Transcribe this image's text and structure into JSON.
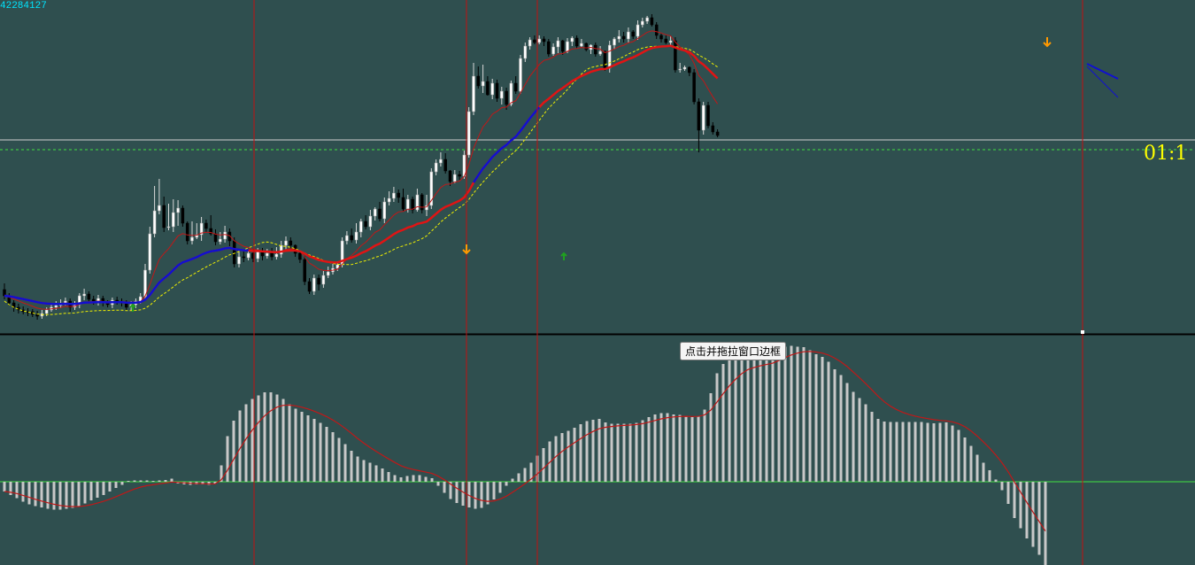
{
  "top_left_label": "42284127",
  "price_label": "01:1",
  "tooltip": "点击并拖拉窗口边框",
  "colors": {
    "background": "#2f4f4f",
    "bull_candle": "#ffffff",
    "bear_candle": "#000000",
    "ma_fast": "#c01818",
    "ma_mid": "#e01414",
    "ma_slow": "#f0f000",
    "ma_blue": "#1010d0",
    "vertical_lines": "#c01010",
    "macd_bars": "#c8c8c8",
    "macd_signal": "#c01818",
    "zero_line": "#40e040",
    "level_line": "#d0d0d0",
    "level_dashed": "#40e040",
    "up_arrow": "#20a020",
    "down_arrow": "#ff9900",
    "id_text": "#00e5ff",
    "price_text": "#ffff00"
  },
  "chart_data": {
    "type": "candlestick",
    "candles": [
      [
        327,
        334,
        320,
        338
      ],
      [
        334,
        342,
        331,
        345
      ],
      [
        342,
        347,
        339,
        352
      ],
      [
        347,
        350,
        343,
        354
      ],
      [
        350,
        352,
        346,
        355
      ],
      [
        352,
        352,
        348,
        357
      ],
      [
        352,
        355,
        349,
        358
      ],
      [
        355,
        357,
        351,
        361
      ],
      [
        357,
        354,
        350,
        360
      ],
      [
        354,
        350,
        347,
        357
      ],
      [
        350,
        347,
        343,
        352
      ],
      [
        347,
        345,
        340,
        350
      ],
      [
        345,
        343,
        338,
        348
      ],
      [
        343,
        340,
        336,
        345
      ],
      [
        340,
        347,
        337,
        352
      ],
      [
        347,
        344,
        340,
        350
      ],
      [
        344,
        334,
        331,
        348
      ],
      [
        334,
        332,
        326,
        339
      ],
      [
        332,
        338,
        329,
        343
      ],
      [
        338,
        340,
        334,
        344
      ],
      [
        340,
        337,
        333,
        345
      ],
      [
        337,
        342,
        334,
        346
      ],
      [
        342,
        344,
        339,
        347
      ],
      [
        344,
        339,
        336,
        348
      ],
      [
        339,
        341,
        335,
        344
      ],
      [
        341,
        342,
        337,
        346
      ],
      [
        342,
        347,
        339,
        350
      ],
      [
        347,
        344,
        340,
        351
      ],
      [
        344,
        340,
        337,
        348
      ],
      [
        340,
        335,
        331,
        343
      ],
      [
        335,
        305,
        298,
        338
      ],
      [
        305,
        264,
        256,
        309
      ],
      [
        264,
        238,
        210,
        268
      ],
      [
        238,
        232,
        202,
        242
      ],
      [
        232,
        257,
        222,
        262
      ],
      [
        257,
        256,
        230,
        260
      ],
      [
        256,
        240,
        225,
        262
      ],
      [
        240,
        235,
        226,
        255
      ],
      [
        235,
        252,
        232,
        256
      ],
      [
        252,
        272,
        250,
        276
      ],
      [
        272,
        268,
        250,
        276
      ],
      [
        268,
        265,
        252,
        270
      ],
      [
        265,
        252,
        245,
        272
      ],
      [
        252,
        258,
        248,
        262
      ],
      [
        258,
        264,
        243,
        266
      ],
      [
        264,
        273,
        259,
        277
      ],
      [
        273,
        270,
        262,
        276
      ],
      [
        270,
        262,
        255,
        274
      ],
      [
        262,
        272,
        258,
        278
      ],
      [
        272,
        298,
        268,
        302
      ],
      [
        298,
        290,
        283,
        302
      ],
      [
        290,
        291,
        284,
        296
      ],
      [
        291,
        286,
        282,
        294
      ],
      [
        286,
        292,
        281,
        296
      ],
      [
        292,
        284,
        280,
        296
      ],
      [
        284,
        289,
        280,
        294
      ],
      [
        289,
        286,
        281,
        292
      ],
      [
        286,
        290,
        280,
        294
      ],
      [
        290,
        287,
        279,
        293
      ],
      [
        287,
        277,
        272,
        291
      ],
      [
        277,
        272,
        267,
        282
      ],
      [
        272,
        277,
        268,
        281
      ],
      [
        277,
        286,
        276,
        290
      ],
      [
        286,
        293,
        284,
        297
      ],
      [
        293,
        318,
        289,
        322
      ],
      [
        318,
        329,
        314,
        332
      ],
      [
        329,
        314,
        310,
        333
      ],
      [
        314,
        321,
        310,
        328
      ],
      [
        321,
        311,
        306,
        325
      ],
      [
        311,
        307,
        301,
        314
      ],
      [
        307,
        303,
        298,
        310
      ],
      [
        303,
        299,
        295,
        306
      ],
      [
        299,
        272,
        268,
        302
      ],
      [
        272,
        266,
        261,
        276
      ],
      [
        266,
        271,
        258,
        274
      ],
      [
        271,
        262,
        252,
        275
      ],
      [
        262,
        250,
        247,
        268
      ],
      [
        250,
        256,
        243,
        259
      ],
      [
        256,
        244,
        237,
        260
      ],
      [
        244,
        236,
        234,
        249
      ],
      [
        236,
        247,
        228,
        250
      ],
      [
        247,
        228,
        223,
        252
      ],
      [
        228,
        224,
        216,
        232
      ],
      [
        224,
        218,
        211,
        228
      ],
      [
        218,
        223,
        214,
        229
      ],
      [
        223,
        236,
        213,
        239
      ],
      [
        236,
        225,
        220,
        240
      ],
      [
        225,
        237,
        222,
        241
      ],
      [
        237,
        220,
        213,
        239
      ],
      [
        220,
        237,
        218,
        241
      ],
      [
        237,
        232,
        220,
        244
      ],
      [
        232,
        194,
        190,
        236
      ],
      [
        194,
        184,
        180,
        198
      ],
      [
        184,
        180,
        172,
        188
      ],
      [
        180,
        193,
        173,
        196
      ],
      [
        193,
        205,
        192,
        210
      ],
      [
        205,
        197,
        192,
        207
      ],
      [
        197,
        199,
        193,
        203
      ],
      [
        199,
        175,
        170,
        202
      ],
      [
        175,
        126,
        121,
        178
      ],
      [
        126,
        86,
        71,
        130
      ],
      [
        86,
        97,
        75,
        100
      ],
      [
        97,
        92,
        73,
        105
      ],
      [
        92,
        107,
        86,
        108
      ],
      [
        107,
        94,
        89,
        112
      ],
      [
        94,
        111,
        90,
        115
      ],
      [
        111,
        103,
        98,
        118
      ],
      [
        103,
        118,
        99,
        124
      ],
      [
        118,
        94,
        91,
        120
      ],
      [
        94,
        103,
        86,
        106
      ],
      [
        103,
        66,
        62,
        106
      ],
      [
        66,
        52,
        48,
        70
      ],
      [
        52,
        45,
        42,
        56
      ],
      [
        45,
        48,
        40,
        50
      ],
      [
        48,
        44,
        40,
        50
      ],
      [
        44,
        47,
        41,
        52
      ],
      [
        47,
        61,
        44,
        64
      ],
      [
        61,
        53,
        49,
        63
      ],
      [
        53,
        46,
        42,
        60
      ],
      [
        46,
        58,
        45,
        62
      ],
      [
        58,
        47,
        43,
        60
      ],
      [
        47,
        43,
        41,
        52
      ],
      [
        43,
        52,
        40,
        55
      ],
      [
        52,
        49,
        44,
        53
      ],
      [
        49,
        56,
        48,
        58
      ],
      [
        56,
        51,
        50,
        61
      ],
      [
        51,
        61,
        48,
        64
      ],
      [
        61,
        58,
        52,
        63
      ],
      [
        58,
        77,
        57,
        80
      ],
      [
        77,
        51,
        46,
        82
      ],
      [
        51,
        44,
        42,
        56
      ],
      [
        44,
        41,
        34,
        48
      ],
      [
        41,
        44,
        36,
        48
      ],
      [
        44,
        36,
        31,
        48
      ],
      [
        36,
        41,
        34,
        44
      ],
      [
        41,
        28,
        23,
        45
      ],
      [
        28,
        24,
        20,
        31
      ],
      [
        24,
        20,
        18,
        27
      ],
      [
        20,
        28,
        16,
        30
      ],
      [
        28,
        40,
        25,
        44
      ],
      [
        40,
        44,
        38,
        48
      ],
      [
        44,
        48,
        40,
        50
      ],
      [
        48,
        46,
        41,
        51
      ],
      [
        46,
        79,
        42,
        82
      ],
      [
        79,
        78,
        71,
        82
      ],
      [
        78,
        76,
        74,
        80
      ],
      [
        76,
        82,
        75,
        86
      ],
      [
        82,
        115,
        78,
        118
      ],
      [
        115,
        147,
        111,
        172
      ],
      [
        147,
        119,
        115,
        152
      ],
      [
        119,
        142,
        115,
        145
      ],
      [
        142,
        149,
        138,
        152
      ],
      [
        149,
        153,
        146,
        155
      ]
    ],
    "macd_histogram": [
      -0.22,
      -0.3,
      -0.37,
      -0.45,
      -0.51,
      -0.55,
      -0.58,
      -0.61,
      -0.63,
      -0.63,
      -0.61,
      -0.59,
      -0.56,
      -0.49,
      -0.42,
      -0.36,
      -0.3,
      -0.22,
      -0.14,
      -0.07,
      0.0,
      0.03,
      0.03,
      0.03,
      0.0,
      0.03,
      0.04,
      0.07,
      -0.04,
      -0.06,
      -0.07,
      -0.06,
      -0.06,
      -0.07,
      -0.04,
      0.37,
      1.03,
      1.38,
      1.61,
      1.75,
      1.87,
      1.95,
      2.02,
      2.02,
      1.97,
      1.87,
      1.75,
      1.65,
      1.58,
      1.5,
      1.42,
      1.33,
      1.24,
      1.12,
      0.99,
      0.85,
      0.7,
      0.57,
      0.49,
      0.43,
      0.37,
      0.3,
      0.22,
      0.15,
      0.1,
      0.13,
      0.15,
      0.15,
      0.11,
      0.08,
      -0.09,
      -0.25,
      -0.39,
      -0.48,
      -0.54,
      -0.58,
      -0.61,
      -0.59,
      -0.51,
      -0.4,
      -0.25,
      -0.09,
      0.07,
      0.19,
      0.31,
      0.43,
      0.59,
      0.76,
      0.91,
      1.03,
      1.1,
      1.15,
      1.22,
      1.3,
      1.37,
      1.4,
      1.42,
      1.34,
      1.31,
      1.31,
      1.31,
      1.31,
      1.33,
      1.39,
      1.46,
      1.52,
      1.55,
      1.55,
      1.52,
      1.51,
      1.49,
      1.46,
      1.48,
      1.63,
      2.0,
      2.45,
      2.66,
      2.79,
      2.85,
      2.9,
      2.85,
      2.75,
      2.75,
      2.75,
      2.79,
      2.95,
      3.05,
      3.07,
      3.05,
      3.04,
      2.97,
      2.88,
      2.82,
      2.71,
      2.54,
      2.41,
      2.23,
      2.03,
      1.89,
      1.75,
      1.58,
      1.42,
      1.36,
      1.35,
      1.35,
      1.35,
      1.35,
      1.35,
      1.35,
      1.33,
      1.32,
      1.33,
      1.34,
      1.27,
      1.17,
      1.0,
      0.81,
      0.61,
      0.43,
      0.26,
      0.05,
      -0.19,
      -0.5,
      -0.82,
      -1.05,
      -1.28,
      -1.47,
      -1.65,
      -1.88
    ]
  }
}
